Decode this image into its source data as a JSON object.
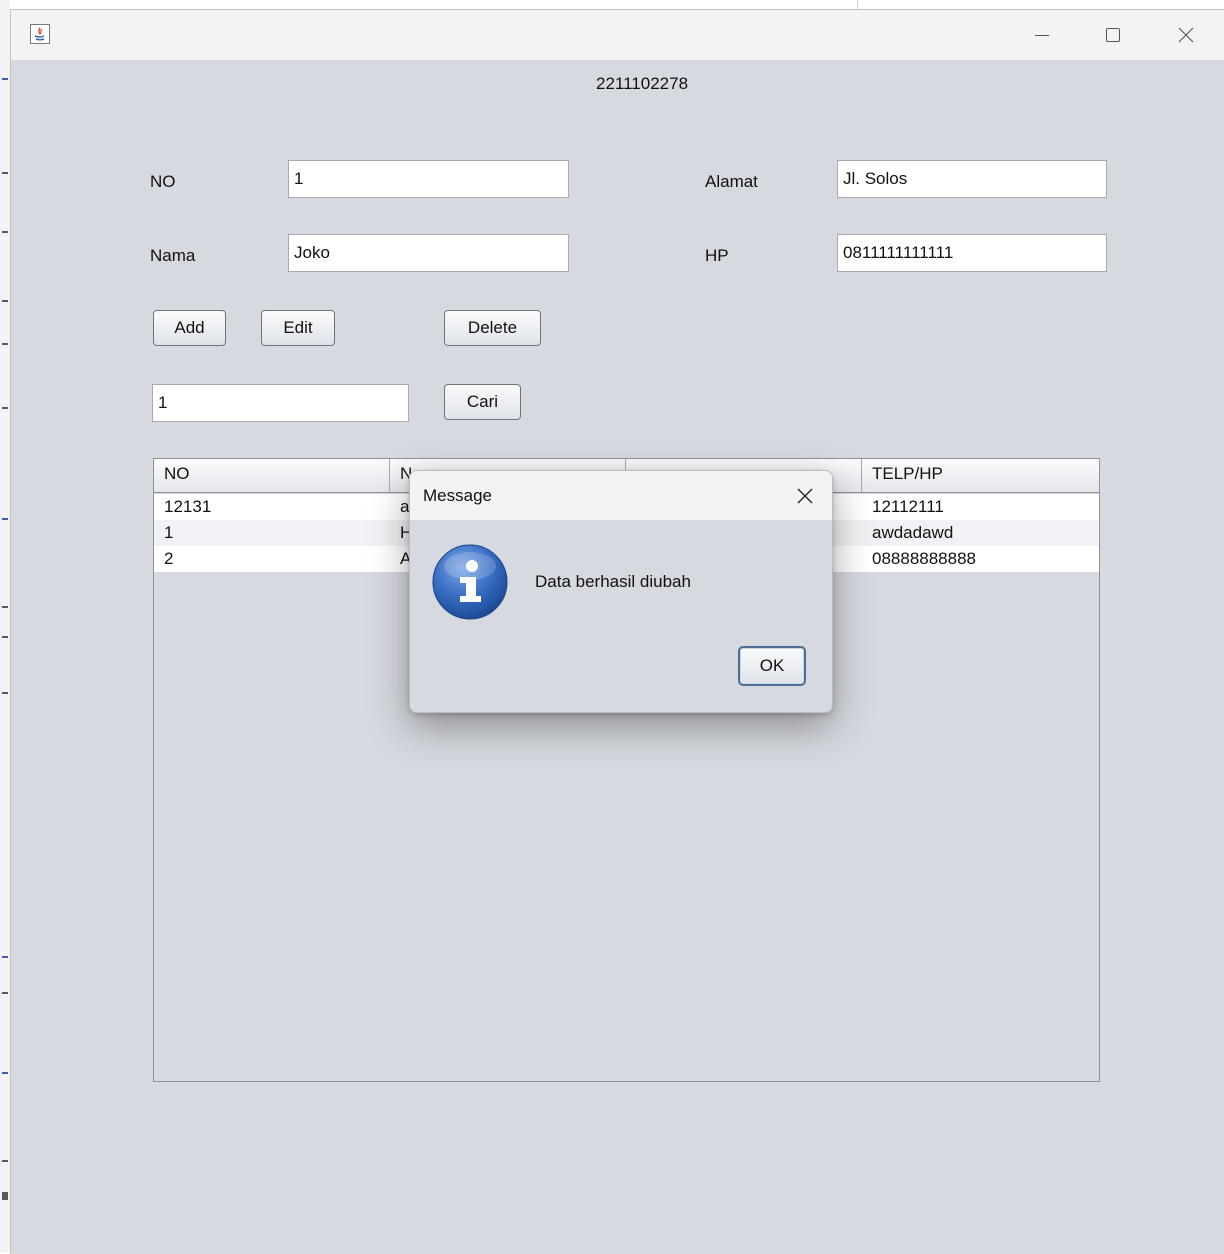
{
  "window": {
    "title": "2211102278",
    "controls": [
      "minimize",
      "maximize",
      "close"
    ]
  },
  "form": {
    "no_label": "NO",
    "no_value": "1",
    "nama_label": "Nama",
    "nama_value": "Joko",
    "alamat_label": "Alamat",
    "alamat_value": "Jl. Solos",
    "hp_label": "HP",
    "hp_value": "0811111111111"
  },
  "buttons": {
    "add": "Add",
    "edit": "Edit",
    "delete": "Delete",
    "cari": "Cari"
  },
  "search": {
    "value": "1"
  },
  "table": {
    "headers": [
      "NO",
      "N",
      "",
      "TELP/HP"
    ],
    "rows": [
      [
        "12131",
        "a",
        "",
        "12112111"
      ],
      [
        "1",
        "H",
        "",
        "awdadawd"
      ],
      [
        "2",
        "A",
        "",
        "08888888888"
      ]
    ]
  },
  "dialog": {
    "title": "Message",
    "message": "Data berhasil diubah",
    "ok_label": "OK",
    "icon": "info-icon"
  },
  "colors": {
    "window_bg": "#d6d9e0",
    "titlebar_bg": "#f3f3f3",
    "info_icon_blue": "#2f63b5"
  }
}
